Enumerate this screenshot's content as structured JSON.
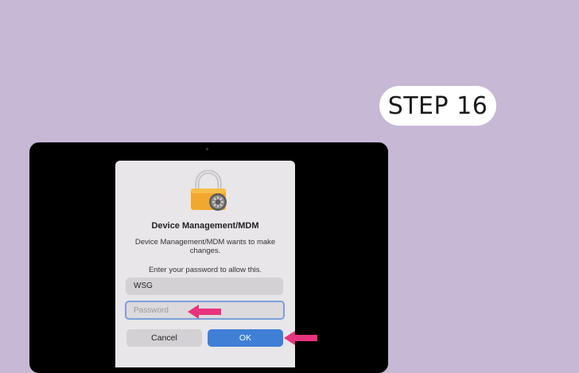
{
  "step_badge": {
    "label": "STEP 16"
  },
  "dialog": {
    "icon": "padlock-with-gear-icon",
    "title": "Device Management/MDM",
    "message": "Device Management/MDM wants to make changes.",
    "prompt": "Enter your password to allow this.",
    "username": "WSG",
    "password_placeholder": "Password",
    "cancel_label": "Cancel",
    "ok_label": "OK"
  },
  "annotations": {
    "arrow_icon": "arrow-left-icon",
    "arrow_color": "#e8337e"
  },
  "colors": {
    "background": "#c7b8d6",
    "primary_button": "#3f7fd6",
    "focus_ring": "#7c9fda"
  }
}
